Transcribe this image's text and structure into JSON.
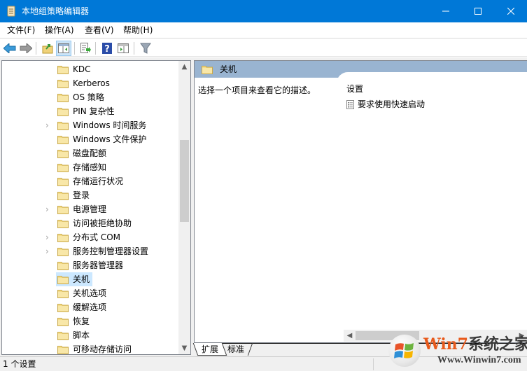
{
  "window": {
    "title": "本地组策略编辑器",
    "controls": {
      "minimize": "minimize",
      "maximize": "maximize",
      "close": "close"
    },
    "accent_color": "#0078d7"
  },
  "menu": [
    {
      "label": "文件(F)"
    },
    {
      "label": "操作(A)"
    },
    {
      "label": "查看(V)"
    },
    {
      "label": "帮助(H)"
    }
  ],
  "toolbar": {
    "buttons": [
      {
        "icon": "back-arrow-icon",
        "label": "后退"
      },
      {
        "icon": "forward-arrow-icon",
        "label": "前进"
      },
      {
        "icon": "up-folder-icon",
        "label": "向上一级"
      },
      {
        "icon": "show-hide-console-tree-icon",
        "label": "显示/隐藏控制台树",
        "active": true
      },
      {
        "icon": "export-list-icon",
        "label": "导出列表"
      },
      {
        "icon": "help-icon",
        "label": "帮助"
      },
      {
        "icon": "show-hide-action-pane-icon",
        "label": "显示/隐藏操作窗格"
      },
      {
        "icon": "filter-icon",
        "label": "筛选"
      }
    ]
  },
  "tree": {
    "items": [
      {
        "label": "KDC",
        "expandable": false
      },
      {
        "label": "Kerberos",
        "expandable": false
      },
      {
        "label": "OS 策略",
        "expandable": false
      },
      {
        "label": "PIN 复杂性",
        "expandable": false
      },
      {
        "label": "Windows 时间服务",
        "expandable": true
      },
      {
        "label": "Windows 文件保护",
        "expandable": false
      },
      {
        "label": "磁盘配额",
        "expandable": false
      },
      {
        "label": "存储感知",
        "expandable": false
      },
      {
        "label": "存储运行状况",
        "expandable": false
      },
      {
        "label": "登录",
        "expandable": false
      },
      {
        "label": "电源管理",
        "expandable": true
      },
      {
        "label": "访问被拒绝协助",
        "expandable": false
      },
      {
        "label": "分布式 COM",
        "expandable": true
      },
      {
        "label": "服务控制管理器设置",
        "expandable": true
      },
      {
        "label": "服务器管理器",
        "expandable": false
      },
      {
        "label": "关机",
        "expandable": false,
        "selected": true
      },
      {
        "label": "关机选项",
        "expandable": false
      },
      {
        "label": "缓解选项",
        "expandable": false
      },
      {
        "label": "恢复",
        "expandable": false
      },
      {
        "label": "脚本",
        "expandable": false
      },
      {
        "label": "可移动存储访问",
        "expandable": false
      }
    ],
    "scroll": {
      "up": "scroll-up",
      "down": "scroll-down"
    }
  },
  "detail": {
    "header_title": "关机",
    "description": "选择一个项目来查看它的描述。",
    "settings_column_header": "设置",
    "settings": [
      {
        "label": "要求使用快速启动"
      }
    ],
    "header_color": "#99b4d1"
  },
  "tabs": [
    {
      "label": "扩展",
      "active": true
    },
    {
      "label": "标准",
      "active": false
    }
  ],
  "status": {
    "text": "1 个设置"
  },
  "watermark": {
    "brand_part1": "Win7",
    "brand_part2": "系统之家",
    "url": "Www.Winwin7.com"
  }
}
